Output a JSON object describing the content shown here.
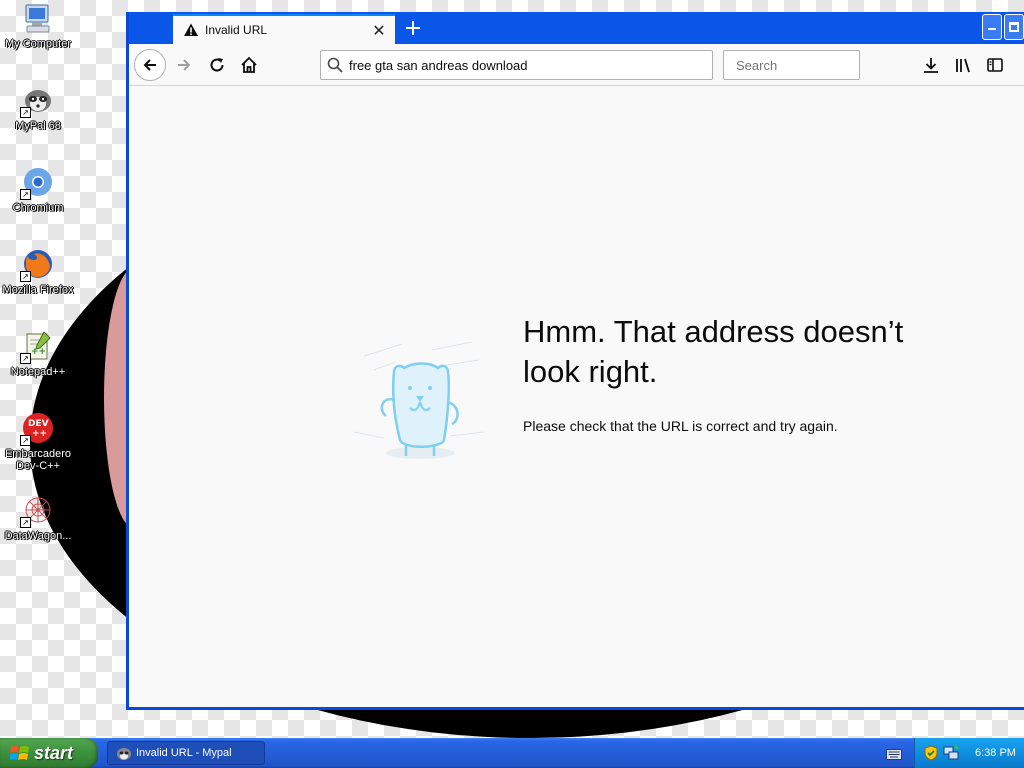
{
  "desktop": {
    "icons": [
      {
        "label": "My Computer",
        "icon": "computer-icon"
      },
      {
        "label": "MyPal 68",
        "icon": "raccoon-icon"
      },
      {
        "label": "Chromium",
        "icon": "chromium-icon"
      },
      {
        "label": "Mozilla Firefox",
        "icon": "firefox-icon"
      },
      {
        "label": "Notepad++",
        "icon": "notepad-plus-plus-icon"
      },
      {
        "label": "Embarcadero Dev-C++",
        "icon": "dev-cpp-icon"
      },
      {
        "label": "DataWagon...",
        "icon": "datawagon-icon"
      }
    ]
  },
  "browser": {
    "tab": {
      "title": "Invalid URL",
      "icon": "warning-icon"
    },
    "url": "free gta san andreas download",
    "search_placeholder": "Search",
    "error": {
      "title": "Hmm. That address doesn’t look right.",
      "description": "Please check that the URL is correct and try again."
    }
  },
  "taskbar": {
    "start_label": "start",
    "task_label": "Invalid URL - Mypal",
    "clock": "6:38 PM"
  },
  "colors": {
    "xp_blue": "#0a56e8",
    "start_green": "#3c8f3c",
    "tray_blue": "#0f8ee0",
    "mascot": "#7fd0f0"
  }
}
